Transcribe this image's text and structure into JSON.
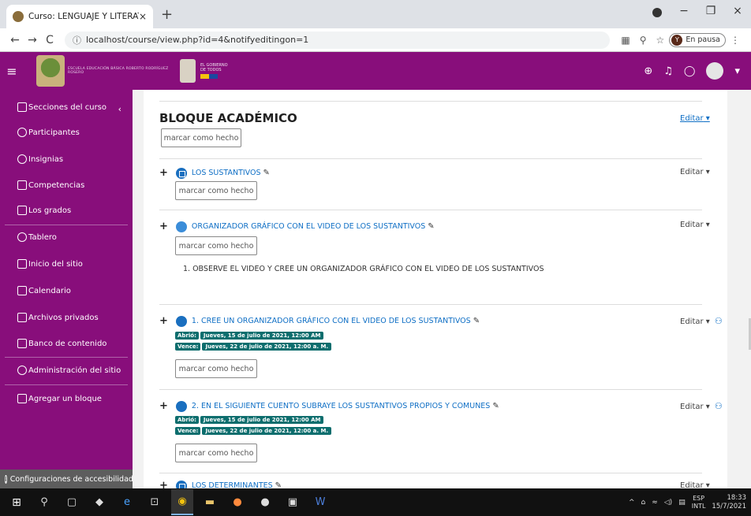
{
  "browser": {
    "tab_title": "Curso: LENGUAJE Y LITERATURA",
    "tab_close": "×",
    "new_tab": "+",
    "window_controls": [
      "−",
      "❐",
      "×"
    ],
    "url": "localhost/course/view.php?id=4&notifyeditingon=1",
    "pause_label": "En pausa",
    "nav": {
      "back": "←",
      "forward": "→",
      "reload": "C"
    }
  },
  "header": {
    "school_name": "ESCUELA EDUCACIÓN BÁSICA ROBERTO RODRÍGUEZ ROSERO",
    "gob_text": "EL GOBIERNO DE TODOS"
  },
  "sidebar": {
    "items": [
      {
        "label": "Secciones del curso",
        "icon": "list-icon"
      },
      {
        "label": "Participantes",
        "icon": "users-icon"
      },
      {
        "label": "Insignias",
        "icon": "badge-icon"
      },
      {
        "label": "Competencias",
        "icon": "star-icon"
      },
      {
        "label": "Los grados",
        "icon": "table-icon"
      },
      {
        "label": "Tablero",
        "icon": "dashboard-icon"
      },
      {
        "label": "Inicio del sitio",
        "icon": "home-icon"
      },
      {
        "label": "Calendario",
        "icon": "calendar-icon"
      },
      {
        "label": "Archivos privados",
        "icon": "file-icon"
      },
      {
        "label": "Banco de contenido",
        "icon": "folder-icon"
      },
      {
        "label": "Administración del sitio",
        "icon": "gear-icon"
      },
      {
        "label": "Agregar un bloque",
        "icon": "plus-square-icon"
      }
    ],
    "accessibility": "Configuraciones de accesibilidad"
  },
  "content": {
    "block_title": "BLOQUE ACADÉMICO",
    "editar": "Editar",
    "done_label": "marcar como hecho",
    "activities": [
      {
        "title": "LOS SUSTANTIVOS"
      },
      {
        "title": "ORGANIZADOR GRÁFICO CON EL VIDEO DE LOS SUSTANTIVOS",
        "description": "1. OBSERVE EL VIDEO Y CREE UN ORGANIZADOR GRÁFICO CON EL VIDEO DE LOS SUSTANTIVOS"
      },
      {
        "title": "1. CREE UN ORGANIZADOR GRÁFICO CON EL VIDEO DE LOS SUSTANTIVOS",
        "opened_key": "Abrió:",
        "opened": "Jueves, 15 de julio de 2021, 12:00 AM",
        "due_key": "Vence:",
        "due": "Jueves, 22 de julio de 2021, 12:00 a. M."
      },
      {
        "title": "2. EN EL SIGUIENTE CUENTO SUBRAYE LOS SUSTANTIVOS PROPIOS Y COMUNES",
        "opened_key": "Abrió:",
        "opened": "Jueves, 15 de julio de 2021, 12:00 AM",
        "due_key": "Vence:",
        "due": "Jueves, 22 de julio de 2021, 12:00 a. M."
      },
      {
        "title": "LOS DETERMINANTES"
      }
    ]
  },
  "taskbar": {
    "lang1": "ESP",
    "lang2": "INTL",
    "time": "18:33",
    "date": "15/7/2021"
  },
  "colors": {
    "brand_purple": "#880e7b",
    "badge_teal": "#0d6e6e",
    "link_blue": "#0f6fc5"
  }
}
